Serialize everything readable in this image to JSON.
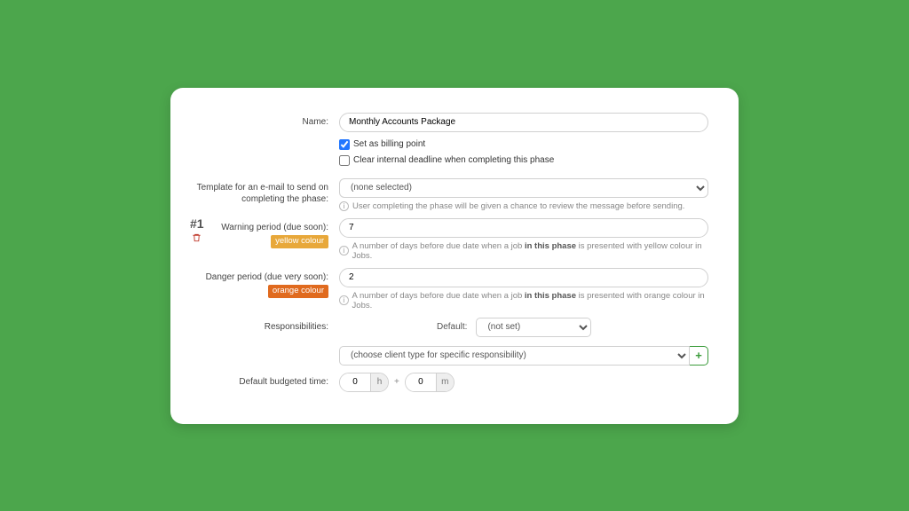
{
  "phase": {
    "seq": "#1",
    "name_label": "Name:",
    "name_value": "Monthly Accounts Package",
    "billing_checked": true,
    "billing_label": "Set as billing point",
    "clear_checked": false,
    "clear_label": "Clear internal deadline when completing this phase",
    "email_template_label": "Template for an e-mail to send on completing the phase:",
    "email_template_value": "(none selected)",
    "email_template_help": "User completing the phase will be given a chance to review the message before sending.",
    "warning_label": "Warning period (due soon):",
    "warning_badge": "yellow colour",
    "warning_value": "7",
    "warning_help_pre": "A number of days before due date when a job ",
    "warning_help_bold": "in this phase",
    "warning_help_post": " is presented with yellow colour in Jobs.",
    "danger_label": "Danger period (due very soon):",
    "danger_badge": "orange colour",
    "danger_value": "2",
    "danger_help_pre": "A number of days before due date when a job ",
    "danger_help_bold": "in this phase",
    "danger_help_post": " is presented with orange colour in Jobs.",
    "resp_label": "Responsibilities:",
    "resp_default_label": "Default:",
    "resp_default_value": "(not set)",
    "resp_clienttype_value": "(choose client type for specific responsibility)",
    "budget_label": "Default budgeted time:",
    "budget_hours": "0",
    "budget_hours_unit": "h",
    "budget_plus": "+",
    "budget_minutes": "0",
    "budget_minutes_unit": "m",
    "add_label": "+"
  }
}
